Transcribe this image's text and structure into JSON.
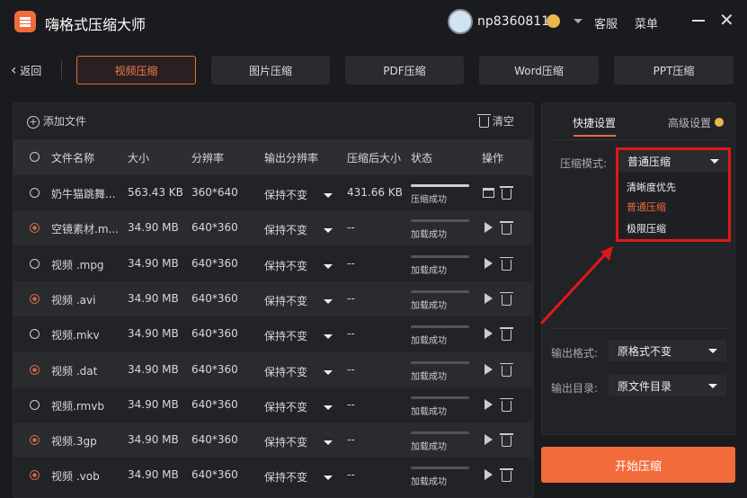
{
  "app": {
    "title": "嗨格式压缩大师",
    "username": "np8360811",
    "service": "客服",
    "menu": "菜单"
  },
  "nav": {
    "back": "返回",
    "tabs": [
      {
        "label": "视频压缩",
        "active": true
      },
      {
        "label": "图片压缩"
      },
      {
        "label": "PDF压缩"
      },
      {
        "label": "Word压缩"
      },
      {
        "label": "PPT压缩"
      }
    ]
  },
  "toolbar": {
    "add_file": "添加文件",
    "clear": "清空"
  },
  "table": {
    "headers": [
      "文件名称",
      "大小",
      "分辨率",
      "输出分辨率",
      "压缩后大小",
      "状态",
      "操作"
    ],
    "rows": [
      {
        "name": "奶牛猫跳舞...",
        "size": "563.43 KB",
        "res": "360*640",
        "out": "保持不变",
        "after": "431.66 KB",
        "status": "压缩成功",
        "checked": false,
        "done": true
      },
      {
        "name": "空镜素材.m...",
        "size": "34.90 MB",
        "res": "640*360",
        "out": "保持不变",
        "after": "--",
        "status": "加载成功",
        "checked": true
      },
      {
        "name": "视频 .mpg",
        "size": "34.90 MB",
        "res": "640*360",
        "out": "保持不变",
        "after": "--",
        "status": "加载成功",
        "checked": false
      },
      {
        "name": "视频 .avi",
        "size": "34.90 MB",
        "res": "640*360",
        "out": "保持不变",
        "after": "--",
        "status": "加载成功",
        "checked": true
      },
      {
        "name": "视频.mkv",
        "size": "34.90 MB",
        "res": "640*360",
        "out": "保持不变",
        "after": "--",
        "status": "加载成功",
        "checked": false
      },
      {
        "name": "视频 .dat",
        "size": "34.90 MB",
        "res": "640*360",
        "out": "保持不变",
        "after": "--",
        "status": "加载成功",
        "checked": true
      },
      {
        "name": "视频.rmvb",
        "size": "34.90 MB",
        "res": "640*360",
        "out": "保持不变",
        "after": "--",
        "status": "加载成功",
        "checked": false
      },
      {
        "name": "视频.3gp",
        "size": "34.90 MB",
        "res": "640*360",
        "out": "保持不变",
        "after": "--",
        "status": "加载成功",
        "checked": true
      },
      {
        "name": "视频 .vob",
        "size": "34.90 MB",
        "res": "640*360",
        "out": "保持不变",
        "after": "--",
        "status": "加载成功",
        "checked": true
      }
    ]
  },
  "settings": {
    "tab_quick": "快捷设置",
    "tab_advanced": "高级设置",
    "mode_label": "压缩模式:",
    "mode_value": "普通压缩",
    "mode_options": [
      "清晰度优先",
      "普通压缩",
      "极限压缩"
    ],
    "format_label": "输出格式:",
    "format_value": "原格式不变",
    "dir_label": "输出目录:",
    "dir_value": "原文件目录"
  },
  "start_button": "开始压缩",
  "colors": {
    "accent": "#f26b3a",
    "highlight": "#e01818"
  }
}
